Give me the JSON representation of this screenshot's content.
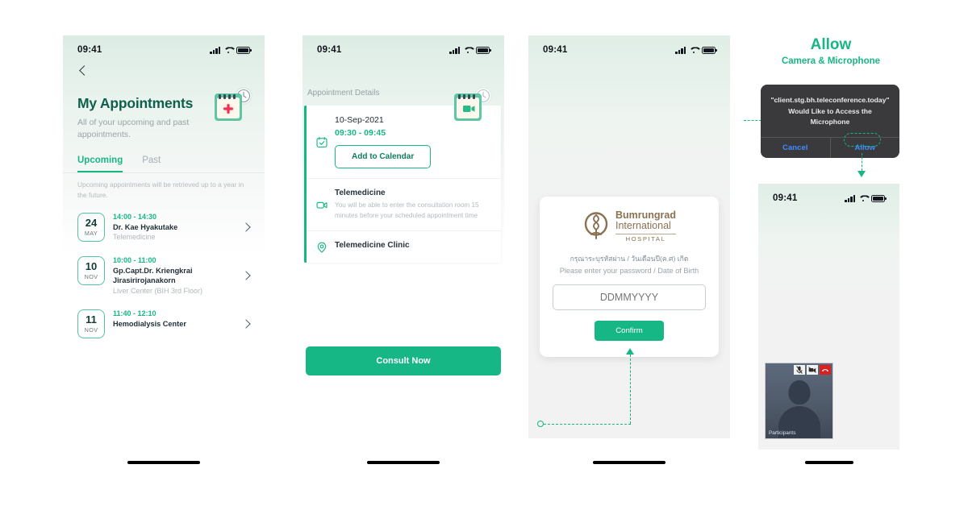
{
  "screens": {
    "appointments": {
      "status_time": "09:41",
      "back_icon": "chevron-left-icon",
      "hero_icon": "calendar-plus-clock-icon",
      "title": "My Appointments",
      "subtitle": "All of your upcoming and past appointments.",
      "tabs": [
        {
          "label": "Upcoming",
          "active": true
        },
        {
          "label": "Past",
          "active": false
        }
      ],
      "note": "Upcoming appointments will be retrieved up to a year in the future.",
      "items": [
        {
          "day": "24",
          "month": "MAY",
          "time": "14:00 - 14:30",
          "name": "Dr. Kae Hyakutake",
          "location": "Telemedicine"
        },
        {
          "day": "10",
          "month": "NOV",
          "time": "10:00 - 11:00",
          "name": "Gp.Capt.Dr. Kriengkrai Jirasirirojanakorn",
          "location": "Liver Center (BIH 3rd Floor)"
        },
        {
          "day": "11",
          "month": "NOV",
          "time": "11:40 - 12:10",
          "name": "Hemodialysis Center",
          "location": ""
        }
      ]
    },
    "details": {
      "status_time": "09:41",
      "hero_icon": "calendar-video-clock-icon",
      "section_title": "Appointment Details",
      "date": "10-Sep-2021",
      "time": "09:30 - 09:45",
      "add_to_calendar": "Add to Calendar",
      "telemedicine_title": "Telemedicine",
      "telemedicine_desc": "You will be able to enter the consultation room 15 minutes before your scheduled appointment time",
      "clinic": "Telemedicine Clinic",
      "cta": "Consult Now"
    },
    "login": {
      "status_time": "09:41",
      "brand_line1": "Bumrungrad",
      "brand_line2": "International",
      "brand_line3": "HOSPITAL",
      "prompt_th": "กรุณาระบุรหัสผ่าน / วันเดือนปี(ค.ศ) เกิด",
      "prompt_en": "Please enter your password / Date of Birth",
      "field_value": "DDMMYYYY",
      "field_placeholder": "DDMMYYYY",
      "confirm": "Confirm"
    },
    "call": {
      "status_time": "09:41",
      "tile_label": "Participants",
      "controls": [
        {
          "icon": "microphone-mute-icon",
          "kind": "light"
        },
        {
          "icon": "camera-off-icon",
          "kind": "light"
        },
        {
          "icon": "end-call-icon",
          "kind": "red"
        }
      ]
    }
  },
  "permission": {
    "heading": "Allow",
    "subheading": "Camera & Microphone",
    "dialog_text": "\"client.stg.bh.teleconference.today\" Would Like to Access the Microphone",
    "cancel": "Cancel",
    "allow": "Allow"
  },
  "colors": {
    "accent": "#17b685",
    "title": "#0e5f4c",
    "brand": "#8a7152",
    "danger": "#d9201f",
    "dialog_bg": "#3a3a3c"
  }
}
